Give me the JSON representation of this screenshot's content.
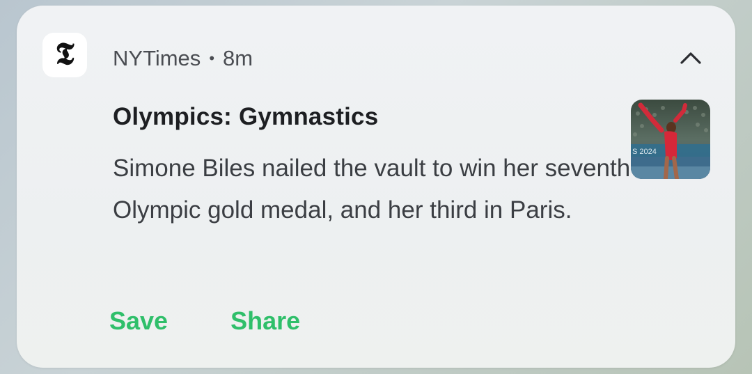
{
  "notification": {
    "app_name": "NYTimes",
    "separator": "•",
    "time_ago": "8m",
    "app_icon_glyph": "𝕿",
    "app_icon_name": "nyt-logo-icon",
    "collapse_icon": "chevron-up-icon",
    "title": "Olympics: Gymnastics",
    "body": "Simone Biles nailed the vault to win her seventh career Olympic gold medal, and her third in Paris.",
    "thumbnail_caption": "S 2024",
    "actions": [
      {
        "label": "Save"
      },
      {
        "label": "Share"
      }
    ],
    "accent_color": "#2fbf6a"
  }
}
